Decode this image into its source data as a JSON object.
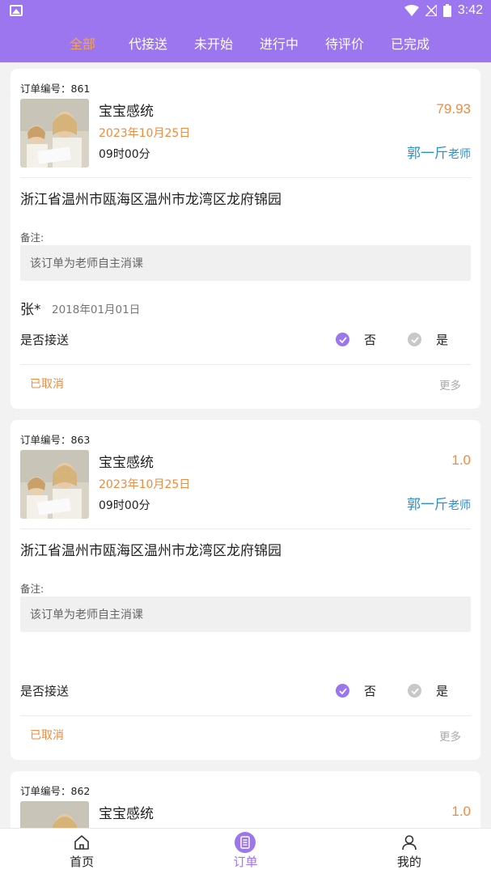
{
  "status_bar": {
    "time": "3:42"
  },
  "tabs": [
    {
      "label": "全部",
      "active": true
    },
    {
      "label": "代接送",
      "active": false
    },
    {
      "label": "未开始",
      "active": false
    },
    {
      "label": "进行中",
      "active": false
    },
    {
      "label": "待评价",
      "active": false
    },
    {
      "label": "已完成",
      "active": false
    }
  ],
  "orders": [
    {
      "order_no_label": "订单编号：861",
      "title": "宝宝感统",
      "date": "2023年10月25日",
      "time": "09时00分",
      "price": "79.93",
      "teacher_name": "郭一斤",
      "teacher_role": "老师",
      "address": "浙江省温州市瓯海区温州市龙湾区龙府锦园",
      "remark_label": "备注:",
      "remark": "该订单为老师自主消课",
      "student_name": "张*",
      "student_birth": "2018年01月01日",
      "pickup_label": "是否接送",
      "pickup_no": "否",
      "pickup_yes": "是",
      "status": "已取消",
      "more": "更多"
    },
    {
      "order_no_label": "订单编号：863",
      "title": "宝宝感统",
      "date": "2023年10月25日",
      "time": "09时00分",
      "price": "1.0",
      "teacher_name": "郭一斤",
      "teacher_role": "老师",
      "address": "浙江省温州市瓯海区温州市龙湾区龙府锦园",
      "remark_label": "备注:",
      "remark": "该订单为老师自主消课",
      "student_name": "",
      "student_birth": "",
      "pickup_label": "是否接送",
      "pickup_no": "否",
      "pickup_yes": "是",
      "status": "已取消",
      "more": "更多"
    },
    {
      "order_no_label": "订单编号：862",
      "title": "宝宝感统",
      "price": "1.0"
    }
  ],
  "bottom_nav": [
    {
      "label": "首页",
      "icon": "home-icon",
      "active": false
    },
    {
      "label": "订单",
      "icon": "order-icon",
      "active": true
    },
    {
      "label": "我的",
      "icon": "user-icon",
      "active": false
    }
  ],
  "colors": {
    "primary": "#9b76ee",
    "accent": "#f08a3c",
    "teacher": "#2a8fd6"
  }
}
